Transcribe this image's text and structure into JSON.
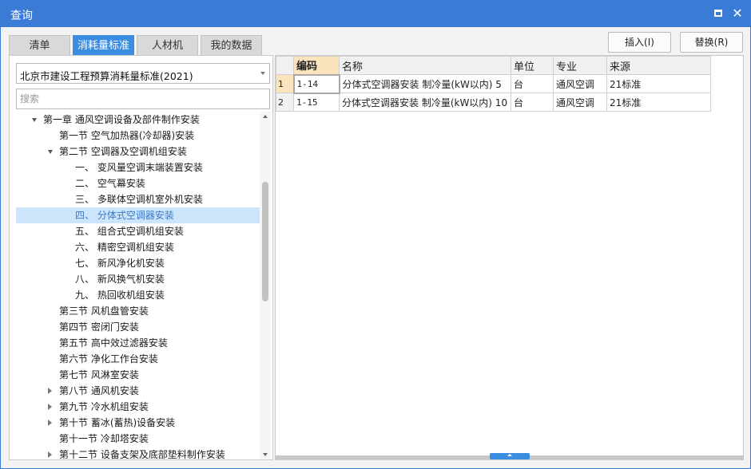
{
  "window": {
    "title": "查询"
  },
  "tabs": [
    {
      "label": "清单",
      "active": false
    },
    {
      "label": "消耗量标准",
      "active": true
    },
    {
      "label": "人材机",
      "active": false
    },
    {
      "label": "我的数据",
      "active": false
    }
  ],
  "actions": {
    "insert_label": "插入(I)",
    "replace_label": "替换(R)"
  },
  "left": {
    "standard_select": "北京市建设工程预算消耗量标准(2021)",
    "search_placeholder": "搜索",
    "tree": [
      {
        "label": "第一章 通风空调设备及部件制作安装",
        "level": 0,
        "arrow": "expanded"
      },
      {
        "label": "第一节 空气加热器(冷却器)安装",
        "level": 1,
        "arrow": "none"
      },
      {
        "label": "第二节 空调器及空调机组安装",
        "level": 1,
        "arrow": "expanded"
      },
      {
        "label": "一、 变风量空调末端装置安装",
        "level": 2,
        "arrow": "none"
      },
      {
        "label": "二、 空气幕安装",
        "level": 2,
        "arrow": "none"
      },
      {
        "label": "三、 多联体空调机室外机安装",
        "level": 2,
        "arrow": "none"
      },
      {
        "label": "四、 分体式空调器安装",
        "level": 2,
        "arrow": "none",
        "selected": true
      },
      {
        "label": "五、 组合式空调机组安装",
        "level": 2,
        "arrow": "none"
      },
      {
        "label": "六、 精密空调机组安装",
        "level": 2,
        "arrow": "none"
      },
      {
        "label": "七、 新风净化机安装",
        "level": 2,
        "arrow": "none"
      },
      {
        "label": "八、 新风换气机安装",
        "level": 2,
        "arrow": "none"
      },
      {
        "label": "九、 热回收机组安装",
        "level": 2,
        "arrow": "none"
      },
      {
        "label": "第三节 风机盘管安装",
        "level": 1,
        "arrow": "none"
      },
      {
        "label": "第四节 密闭门安装",
        "level": 1,
        "arrow": "none"
      },
      {
        "label": "第五节 高中效过滤器安装",
        "level": 1,
        "arrow": "none"
      },
      {
        "label": "第六节 净化工作台安装",
        "level": 1,
        "arrow": "none"
      },
      {
        "label": "第七节 风淋室安装",
        "level": 1,
        "arrow": "none"
      },
      {
        "label": "第八节 通风机安装",
        "level": 1,
        "arrow": "collapsed"
      },
      {
        "label": "第九节 冷水机组安装",
        "level": 1,
        "arrow": "collapsed"
      },
      {
        "label": "第十节 蓄冰(蓄热)设备安装",
        "level": 1,
        "arrow": "collapsed"
      },
      {
        "label": "第十一节 冷却塔安装",
        "level": 1,
        "arrow": "none"
      },
      {
        "label": "第十二节 设备支架及底部垫料制作安装",
        "level": 1,
        "arrow": "collapsed"
      }
    ]
  },
  "grid": {
    "columns": [
      "编码",
      "名称",
      "单位",
      "专业",
      "来源"
    ],
    "rows": [
      {
        "num": "1",
        "code": "1-14",
        "name": "分体式空调器安装 制冷量(kW以内) 5",
        "unit": "台",
        "major": "通风空调",
        "source": "21标准"
      },
      {
        "num": "2",
        "code": "1-15",
        "name": "分体式空调器安装 制冷量(kW以内) 10",
        "unit": "台",
        "major": "通风空调",
        "source": "21标准"
      }
    ]
  },
  "colors": {
    "titlebar": "#3a7bd5",
    "tab_active": "#3a8de0",
    "selection": "#cce5fb",
    "header_highlight": "#fbe3bd"
  }
}
